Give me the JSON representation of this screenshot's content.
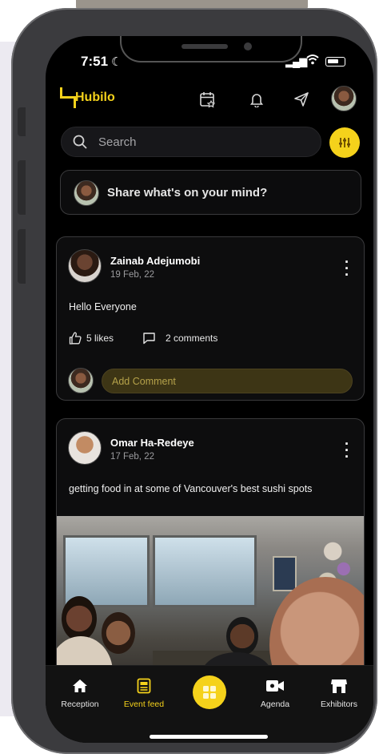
{
  "status": {
    "time": "7:51"
  },
  "header": {
    "brand": "Hubilo",
    "icons": [
      "calendar-star-icon",
      "bell-icon",
      "send-icon",
      "profile-avatar"
    ]
  },
  "search": {
    "placeholder": "Search"
  },
  "composer": {
    "prompt": "Share what's on your mind?"
  },
  "posts": [
    {
      "author": "Zainab Adejumobi",
      "date": "19 Feb, 22",
      "text": "Hello Everyone",
      "likes": "5 likes",
      "comments": "2 comments",
      "comment_placeholder": "Add Comment"
    },
    {
      "author": "Omar Ha-Redeye",
      "date": "17 Feb, 22",
      "text": "getting food in at some of Vancouver's best sushi spots"
    }
  ],
  "tabbar": {
    "items": [
      {
        "label": "Reception",
        "icon": "home-icon"
      },
      {
        "label": "Event feed",
        "icon": "feed-icon",
        "active": true
      },
      {
        "label": "",
        "icon": "grid-icon"
      },
      {
        "label": "Agenda",
        "icon": "video-icon"
      },
      {
        "label": "Exhibitors",
        "icon": "store-icon"
      }
    ]
  },
  "colors": {
    "accent": "#f5d21b",
    "background": "#000000",
    "card_border": "#3a3a3c"
  }
}
